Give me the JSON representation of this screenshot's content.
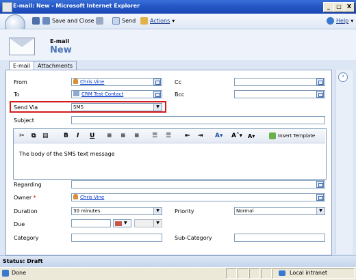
{
  "window": {
    "title": "E-mail: New - Microsoft Internet Explorer",
    "min": "_",
    "max": "□",
    "close": "X"
  },
  "toolbar": {
    "save_close": "Save and Close",
    "send": "Send",
    "actions": "Actions",
    "help": "Help"
  },
  "header": {
    "entity": "E-mail",
    "name": "New"
  },
  "tabs": [
    {
      "label": "E-mail"
    },
    {
      "label": "Attachments"
    }
  ],
  "form": {
    "from": {
      "label": "From",
      "value": "Chris Vine"
    },
    "to": {
      "label": "To",
      "value": "CRM Test Contact"
    },
    "send_via": {
      "label": "Send Via",
      "value": "SMS"
    },
    "subject": {
      "label": "Subject",
      "value": ""
    },
    "cc": {
      "label": "Cc",
      "value": ""
    },
    "bcc": {
      "label": "Bcc",
      "value": ""
    },
    "regarding": {
      "label": "Regarding",
      "value": ""
    },
    "owner": {
      "label": "Owner",
      "required_mark": "*",
      "value": "Chris Vine"
    },
    "duration": {
      "label": "Duration",
      "value": "30 minutes"
    },
    "priority": {
      "label": "Priority",
      "value": "Normal"
    },
    "due": {
      "label": "Due",
      "value": ""
    },
    "category": {
      "label": "Category",
      "value": ""
    },
    "subcategory": {
      "label": "Sub-Category",
      "value": ""
    }
  },
  "editor": {
    "insert_template": "Insert Template",
    "bold": "B",
    "italic": "I",
    "underline": "U",
    "font_grow": "A",
    "font_shrink": "A",
    "body": "The body of the SMS text message"
  },
  "status": {
    "text": "Status: Draft"
  },
  "browser": {
    "done": "Done",
    "zone": "Local intranet"
  },
  "colors": {
    "title": "#2457c5",
    "entity_name": "#4a74b4",
    "highlight": "#d01c1c",
    "link": "#0033cc"
  }
}
